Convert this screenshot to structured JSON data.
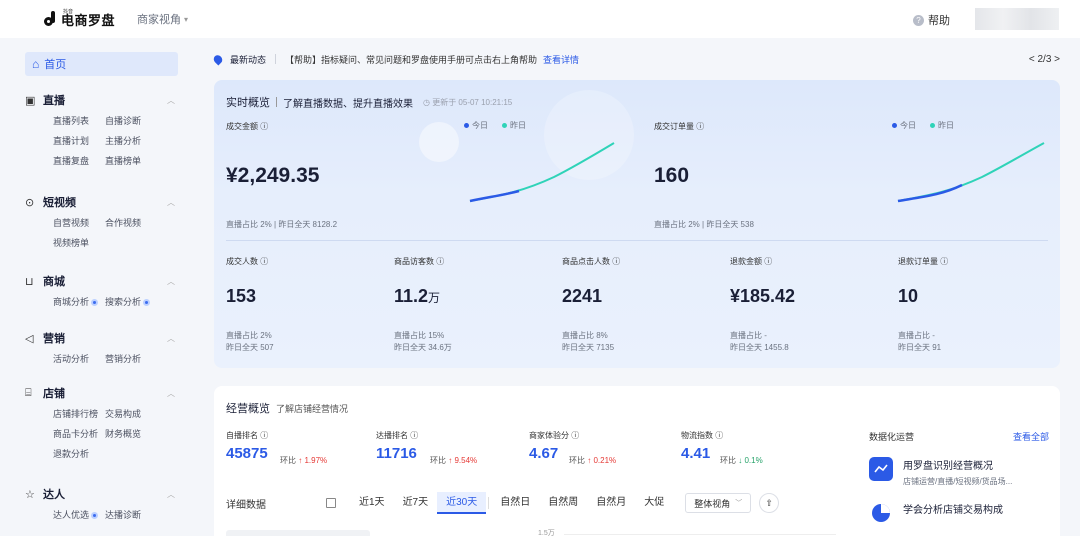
{
  "topbar": {
    "logo_small": "抖音",
    "logo_text": "电商罗盘",
    "merchant_view": "商家视角",
    "help": "帮助"
  },
  "sidebar": {
    "home": "首页",
    "sections": [
      {
        "title": "直播",
        "items": [
          "直播列表",
          "自播诊断",
          "直播计划",
          "主播分析",
          "直播复盘",
          "直播榜单"
        ]
      },
      {
        "title": "短视频",
        "items": [
          "自营视频",
          "合作视频",
          "视频榜单"
        ]
      },
      {
        "title": "商城",
        "items": [
          "商城分析",
          "搜索分析"
        ]
      },
      {
        "title": "营销",
        "items": [
          "活动分析",
          "营销分析"
        ]
      },
      {
        "title": "店铺",
        "items": [
          "店铺排行榜",
          "交易构成",
          "商品卡分析",
          "财务概览",
          "退款分析"
        ]
      },
      {
        "title": "达人",
        "items": [
          "达人优选",
          "达播诊断"
        ]
      }
    ]
  },
  "announcement": {
    "title": "最新动态",
    "message": "【帮助】指标疑问、常见问题和罗盘使用手册可点击右上角帮助",
    "link": "查看详情",
    "pager": "< 2/3 >"
  },
  "realtime": {
    "title": "实时概览",
    "desc": "了解直播数据、提升直播效果",
    "updated": "更新于 05-07 10:21:15",
    "legend_today": "今日",
    "legend_yesterday": "昨日",
    "colors": {
      "today": "#2b5ae6",
      "yesterday": "#2fd3b8"
    },
    "gmv": {
      "label": "成交金额",
      "value": "¥2,249.35",
      "foot_ratio": "直播占比 2%",
      "foot_yday": "昨日全天 8128.2"
    },
    "orders": {
      "label": "成交订单量",
      "value": "160",
      "foot_ratio": "直播占比 2%",
      "foot_yday": "昨日全天 538"
    },
    "small": [
      {
        "label": "成交人数",
        "value": "153",
        "unit": "",
        "ratio": "直播占比 2%",
        "yday": "昨日全天 507"
      },
      {
        "label": "商品访客数",
        "value": "11.2",
        "unit": "万",
        "ratio": "直播占比 15%",
        "yday": "昨日全天 34.6万"
      },
      {
        "label": "商品点击人数",
        "value": "2241",
        "unit": "",
        "ratio": "直播占比 8%",
        "yday": "昨日全天 7135"
      },
      {
        "label": "退款金额",
        "value": "¥185.42",
        "unit": "",
        "ratio": "直播占比 -",
        "yday": "昨日全天 1455.8"
      },
      {
        "label": "退款订单量",
        "value": "10",
        "unit": "",
        "ratio": "直播占比 -",
        "yday": "昨日全天 91"
      }
    ]
  },
  "operations": {
    "title": "经营概览",
    "subtitle": "了解店铺经营情况",
    "kpis": [
      {
        "label": "自播排名",
        "value": "45875",
        "ch_label": "环比",
        "change": "1.97%",
        "dir": "up"
      },
      {
        "label": "达播排名",
        "value": "11716",
        "ch_label": "环比",
        "change": "9.54%",
        "dir": "up"
      },
      {
        "label": "商家体验分",
        "value": "4.67",
        "ch_label": "环比",
        "change": "0.21%",
        "dir": "up"
      },
      {
        "label": "物流指数",
        "value": "4.41",
        "ch_label": "环比",
        "change": "0.1%",
        "dir": "down"
      }
    ],
    "detail_label": "详细数据",
    "tabs": [
      "近1天",
      "近7天",
      "近30天",
      "自然日",
      "自然周",
      "自然月",
      "大促"
    ],
    "active_tab": "近30天",
    "view_select": "整体视角",
    "y_tick": "1.5万",
    "data_ops": {
      "title": "数据化运营",
      "view_all": "查看全部",
      "items": [
        {
          "title": "用罗盘识别经营概况",
          "sub": "店铺运营/直播/短视频/货品场..."
        },
        {
          "title": "学会分析店铺交易构成",
          "sub": ""
        }
      ]
    }
  }
}
